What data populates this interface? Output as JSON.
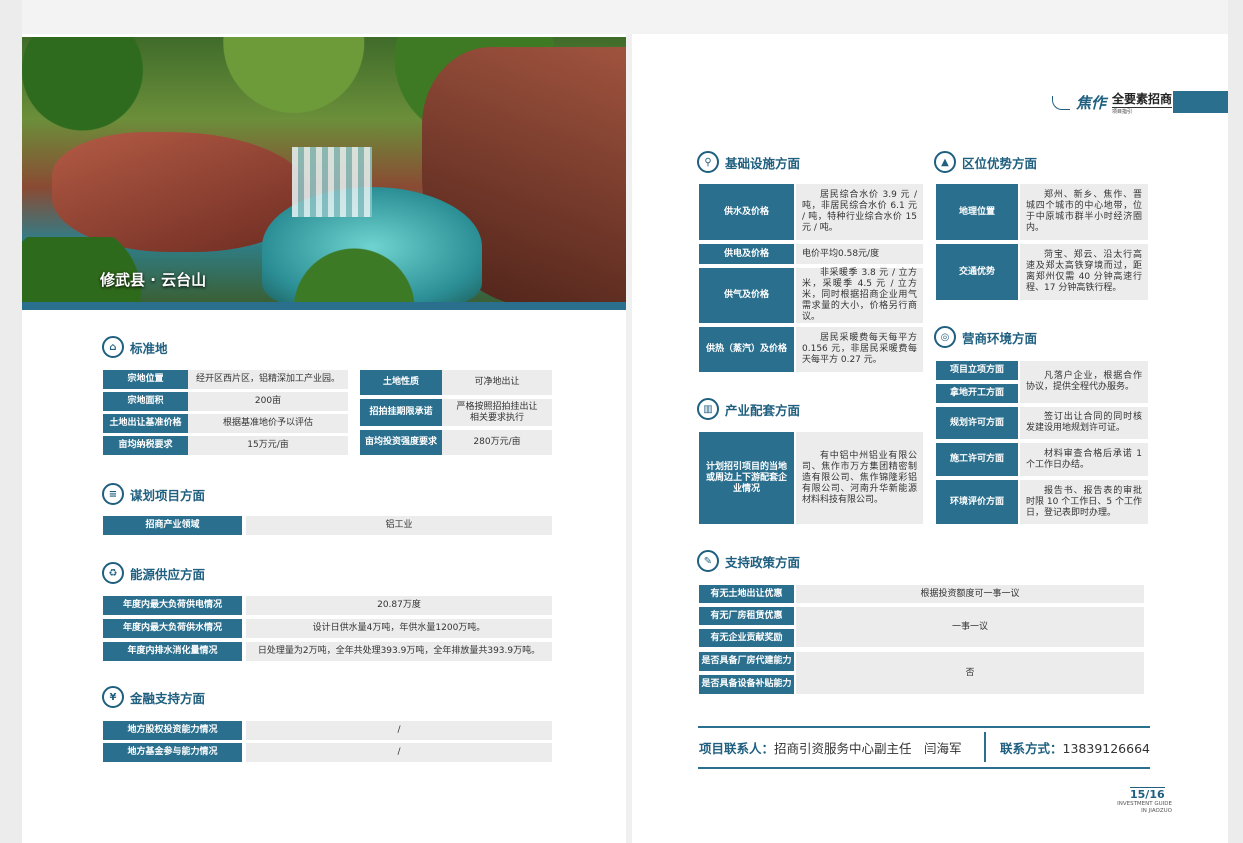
{
  "hero": {
    "caption": "修武县 · 云台山"
  },
  "brand": {
    "name": "焦作",
    "title": "全要素招商",
    "sub": "项目指引"
  },
  "sections": {
    "standard_land": "标准地",
    "planning": "谋划项目方面",
    "energy": "能源供应方面",
    "finance": "金融支持方面",
    "infrastructure": "基础设施方面",
    "industry": "产业配套方面",
    "policy": "支持政策方面",
    "location": "区位优势方面",
    "business": "营商环境方面"
  },
  "standard_land": {
    "rows_left": [
      {
        "label": "宗地位置",
        "value": "经开区西片区，铝精深加工产业园。"
      },
      {
        "label": "宗地面积",
        "value": "200亩"
      },
      {
        "label": "土地出让基准价格",
        "value": "根据基准地价予以评估"
      },
      {
        "label": "亩均纳税要求",
        "value": "15万元/亩"
      }
    ],
    "rows_right": [
      {
        "label": "土地性质",
        "value": "可净地出让"
      },
      {
        "label": "招拍挂期限承诺",
        "value": "严格按照招拍挂出让相关要求执行"
      },
      {
        "label": "亩均投资强度要求",
        "value": "280万元/亩"
      }
    ]
  },
  "planning": {
    "label": "招商产业领域",
    "value": "铝工业"
  },
  "energy": [
    {
      "label": "年度内最大负荷供电情况",
      "value": "20.87万度"
    },
    {
      "label": "年度内最大负荷供水情况",
      "value": "设计日供水量4万吨，年供水量1200万吨。"
    },
    {
      "label": "年度内排水消化量情况",
      "value": "日处理量为2万吨，全年共处理393.9万吨，全年排放量共393.9万吨。"
    }
  ],
  "finance": [
    {
      "label": "地方股权投资能力情况",
      "value": "/"
    },
    {
      "label": "地方基金参与能力情况",
      "value": "/"
    }
  ],
  "infrastructure": [
    {
      "label": "供水及价格",
      "value": "居民综合水价 3.9 元 / 吨，非居民综合水价 6.1 元 / 吨，特种行业综合水价 15 元 / 吨。"
    },
    {
      "label": "供电及价格",
      "value": "电价平均0.58元/度"
    },
    {
      "label": "供气及价格",
      "value": "非采暖季 3.8 元 / 立方米，采暖季 4.5 元 / 立方米，同时根据招商企业用气需求量的大小，价格另行商议。"
    },
    {
      "label": "供热（蒸汽）及价格",
      "value": "居民采暖费每天每平方 0.156 元，非居民采暖费每天每平方 0.27 元。"
    }
  ],
  "industry": {
    "label": "计划招引项目的当地或周边上下游配套企业情况",
    "value": "有中铝中州铝业有限公司、焦作市万方集团精密制造有限公司、焦作锦隆彩铝有限公司、河南升华新能源材料科技有限公司。"
  },
  "policy": {
    "labels": [
      "有无土地出让优惠",
      "有无厂房租赁优惠",
      "有无企业贡献奖励",
      "是否具备厂房代建能力",
      "是否具备设备补贴能力"
    ],
    "values": [
      "根据投资额度可一事一议",
      "一事一议",
      "否"
    ]
  },
  "location": [
    {
      "label": "地理位置",
      "value": "郑州、新乡、焦作、晋城四个城市的中心地带，位于中原城市群半小时经济圈内。"
    },
    {
      "label": "交通优势",
      "value": "菏宝、郑云、沿太行高速及郑太高铁穿境而过，距离郑州仅需 40 分钟高速行程、17 分钟高铁行程。"
    }
  ],
  "business": {
    "labels": [
      "项目立项方面",
      "拿地开工方面",
      "规划许可方面",
      "施工许可方面",
      "环境评价方面"
    ],
    "values": [
      "凡落户企业，根据合作协议，提供全程代办服务。",
      "签订出让合同的同时核发建设用地规划许可证。",
      "材料审查合格后承诺 1 个工作日办结。",
      "报告书、报告表的审批时限 10 个工作日、5 个工作日，登记表即时办理。"
    ]
  },
  "contact": {
    "person_label": "项目联系人：",
    "person_value": "招商引资服务中心副主任　闫海军",
    "phone_label": "联系方式：",
    "phone_value": "13839126664"
  },
  "footer": {
    "page": "15/16",
    "guide": "INVESTMENT GUIDE IN JIAOZUO"
  }
}
